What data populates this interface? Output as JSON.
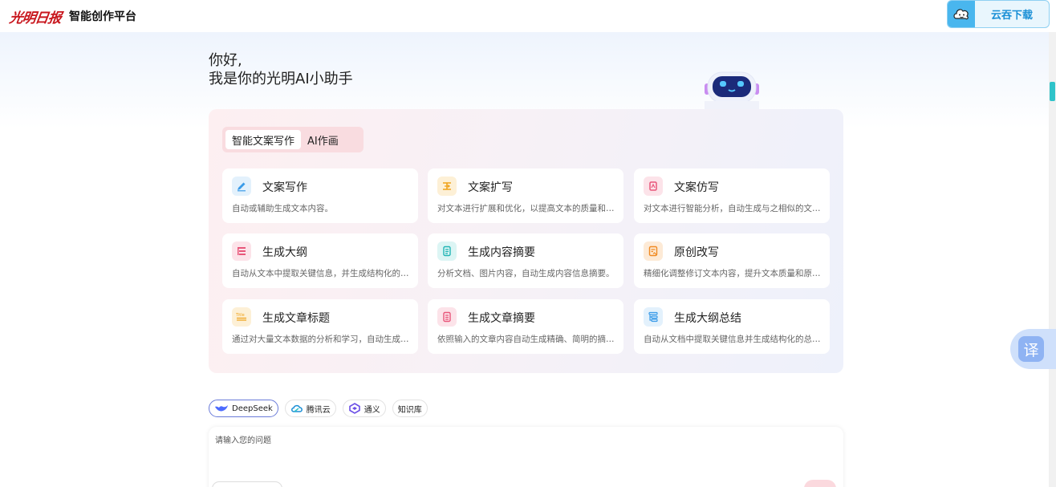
{
  "header": {
    "logo_text": "光明日报",
    "platform_title": "智能创作平台",
    "download_label": "云吞下载"
  },
  "greeting": {
    "line1": "你好,",
    "line2": "我是你的光明AI小助手"
  },
  "tabs": [
    {
      "label": "智能文案写作",
      "active": true
    },
    {
      "label": "AI作画",
      "active": false
    }
  ],
  "cards": [
    {
      "title": "文案写作",
      "desc": "自动或辅助生成文本内容。",
      "icon": "pen-icon",
      "color": "#3a9be8",
      "bg": "#e3f1fc"
    },
    {
      "title": "文案扩写",
      "desc": "对文本进行扩展和优化，以提高文本的质量和可读性。",
      "icon": "expand-icon",
      "color": "#f0a21a",
      "bg": "#fdf0d6"
    },
    {
      "title": "文案仿写",
      "desc": "对文本进行智能分析，自动生成与之相似的文本内容。",
      "icon": "copy-icon",
      "color": "#e8567a",
      "bg": "#fce3e9"
    },
    {
      "title": "生成大纲",
      "desc": "自动从文本中提取关键信息，并生成结构化的大纲。",
      "icon": "outline-icon",
      "color": "#e8567a",
      "bg": "#fce3e9"
    },
    {
      "title": "生成内容摘要",
      "desc": "分析文档、图片内容，自动生成内容信息摘要。",
      "icon": "document-icon",
      "color": "#22b5b5",
      "bg": "#dcf5f4"
    },
    {
      "title": "原创改写",
      "desc": "精细化调整修订文本内容，提升文本质量和原创度。",
      "icon": "rewrite-icon",
      "color": "#f08a22",
      "bg": "#fdead6"
    },
    {
      "title": "生成文章标题",
      "desc": "通过对大量文本数据的分析和学习，自动生成文章标题。",
      "icon": "title-icon",
      "color": "#f0a21a",
      "bg": "#fdf0d6"
    },
    {
      "title": "生成文章摘要",
      "desc": "依照输入的文章内容自动生成精确、简明的摘要。",
      "icon": "summary-icon",
      "color": "#e8567a",
      "bg": "#fce3e9"
    },
    {
      "title": "生成大纲总结",
      "desc": "自动从文档中提取关键信息并生成结构化的总结。",
      "icon": "tree-icon",
      "color": "#3a9be8",
      "bg": "#e3f1fc"
    }
  ],
  "models": [
    {
      "label": "DeepSeek",
      "icon": "deepseek-icon",
      "active": true
    },
    {
      "label": "腾讯云",
      "icon": "tencent-cloud-icon",
      "active": false
    },
    {
      "label": "通义",
      "icon": "tongyi-icon",
      "active": false
    },
    {
      "label": "知识库",
      "icon": "",
      "active": false
    }
  ],
  "input": {
    "placeholder": "请输入您的问题",
    "value": ""
  },
  "translate_label": "译"
}
